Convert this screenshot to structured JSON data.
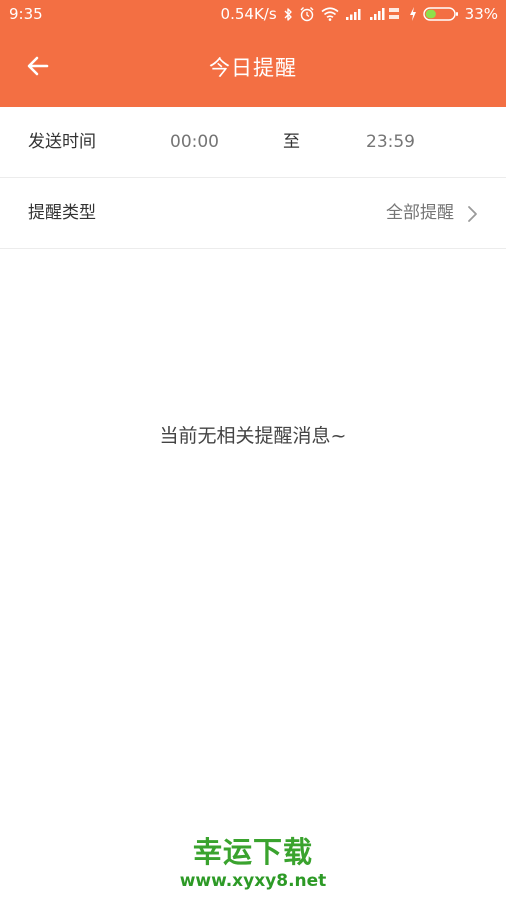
{
  "status_bar": {
    "time": "9:35",
    "net_speed": "0.54K/s",
    "battery_pct": "33%",
    "icons": [
      "bluetooth-icon",
      "alarm-icon",
      "wifi-icon",
      "signal-icon",
      "signal-4g-icon",
      "charging-icon",
      "battery-icon"
    ]
  },
  "header": {
    "title": "今日提醒",
    "back_icon": "arrow-left-icon"
  },
  "send_time": {
    "label": "发送时间",
    "start": "00:00",
    "separator": "至",
    "end": "23:59"
  },
  "remind_type": {
    "label": "提醒类型",
    "value": "全部提醒",
    "icon": "chevron-right-icon"
  },
  "empty_state": {
    "message": "当前无相关提醒消息~"
  },
  "watermark": {
    "title": "幸运下载",
    "url": "www.xyxy8.net"
  },
  "colors": {
    "brand_orange": "#F36F43",
    "watermark_green": "#3aa32e"
  }
}
